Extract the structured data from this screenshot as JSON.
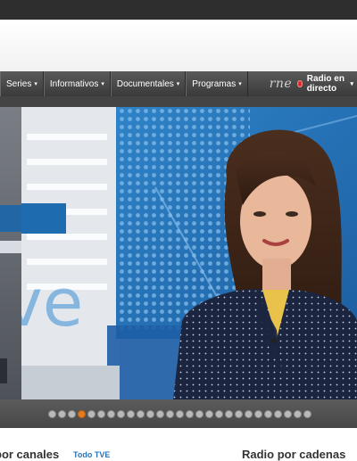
{
  "nav": {
    "items": [
      {
        "label": "Series",
        "arrow": "▾"
      },
      {
        "label": "Informativos",
        "arrow": "▾"
      },
      {
        "label": "Documentales",
        "arrow": "▾"
      },
      {
        "label": "Programas",
        "arrow": "▾"
      }
    ],
    "rne_logo": "rne",
    "radio_live": "Radio en directo",
    "radio_arrow": "▾"
  },
  "carousel": {
    "total_dots": 27,
    "active_index": 3
  },
  "sections": {
    "tv_heading": "por canales",
    "tv_link": "Todo TVE",
    "radio_heading": "Radio por cadenas"
  },
  "colors": {
    "accent_orange": "#e37b1e",
    "link_blue": "#2b73b9",
    "live_red": "#e02a2a"
  }
}
